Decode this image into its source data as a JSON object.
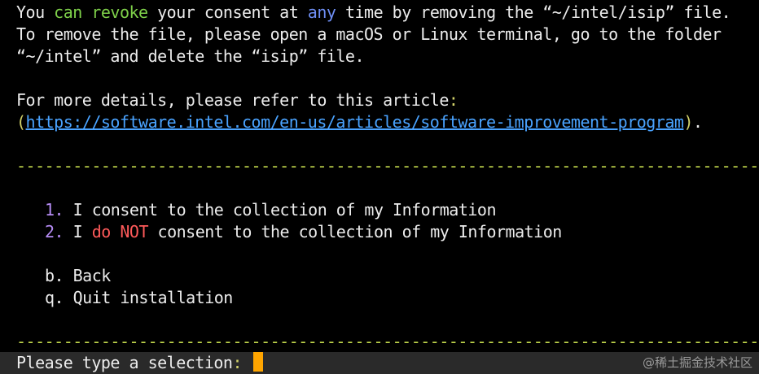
{
  "text": {
    "p1_you": "You ",
    "p1_can": "can",
    "p1_sp1": " ",
    "p1_revoke": "revoke",
    "p1_mid": " your consent at ",
    "p1_any": "any",
    "p1_end": " time by removing the “~/intel/isip” file.",
    "p2": "To remove the file, please open a macOS or Linux terminal, go to the folder",
    "p3": "“~/intel” and delete the “isip” file.",
    "p4_main": "For more details, please refer to this article",
    "p4_colon": ":",
    "p5_open": "(",
    "p5_link": "https://software.intel.com/en-us/articles/software-improvement-program",
    "p5_close": ")",
    "p5_dot": "."
  },
  "separator": "------------------------------------------------------------------------------------------------------------",
  "options": [
    {
      "num": "1.",
      "before": " I consent to the collection of my Information"
    },
    {
      "num": "2.",
      "i": " I ",
      "do": "do",
      "not": "NOT",
      "rest": " consent to the collection of my Information"
    }
  ],
  "nav": [
    {
      "key": "b.",
      "label": " Back"
    },
    {
      "key": "q.",
      "label": " Quit installation"
    }
  ],
  "prompt": {
    "label": "Please type a selection",
    "colon": ":"
  },
  "watermark": "@稀土掘金技术社区",
  "colors": {
    "background": "#000000",
    "text": "#ececec",
    "green": "#7fd14a",
    "blue": "#6f8ff5",
    "yellow": "#d2d26a",
    "red": "#ff5a5a",
    "purple": "#b68cf5",
    "link": "#4aa3ff",
    "separator": "#c2d84c",
    "cursor": "#ffa500"
  }
}
